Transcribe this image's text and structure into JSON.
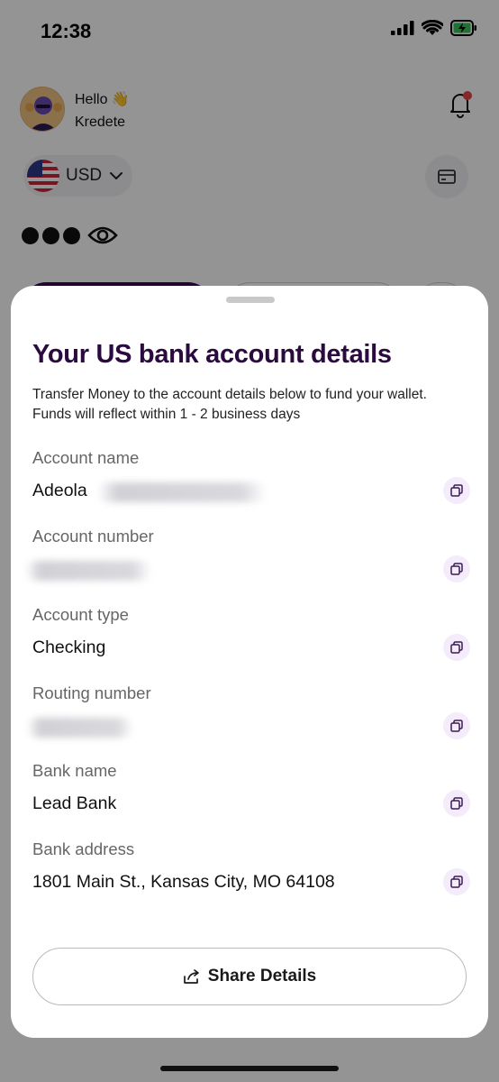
{
  "status_bar": {
    "time": "12:38"
  },
  "header": {
    "greeting": "Hello 👋",
    "user_name": "Kredete"
  },
  "wallet": {
    "currency": "USD",
    "balance_masked": "hidden"
  },
  "sheet": {
    "title": "Your US bank account details",
    "description": "Transfer Money to the account details below to fund your wallet. Funds will reflect within 1 - 2 business days",
    "fields": [
      {
        "label": "Account name",
        "value": "Adeola"
      },
      {
        "label": "Account number",
        "value": ""
      },
      {
        "label": "Account type",
        "value": "Checking"
      },
      {
        "label": "Routing number",
        "value": ""
      },
      {
        "label": "Bank name",
        "value": "Lead Bank"
      },
      {
        "label": "Bank address",
        "value": "1801 Main St., Kansas City, MO 64108"
      }
    ],
    "share_label": "Share Details"
  },
  "colors": {
    "brand_purple": "#2a0a3f",
    "copy_bg": "#f4ecfa",
    "overlay": "rgba(0,0,0,0.42)"
  },
  "icons": {
    "wave": "waving-hand-icon",
    "bell": "bell-icon",
    "flag": "us-flag-icon",
    "caret": "chevron-down-icon",
    "card": "card-icon",
    "eye": "eye-icon",
    "copy": "copy-icon",
    "share": "share-icon"
  }
}
